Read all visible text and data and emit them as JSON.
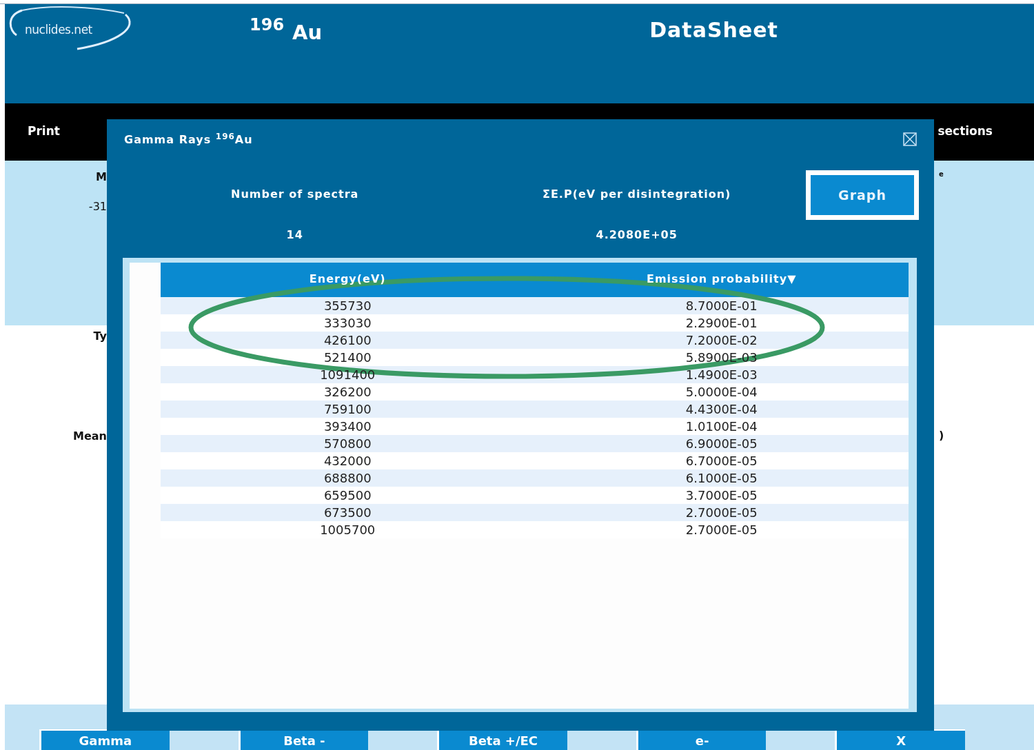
{
  "header": {
    "logo": "nuclides.net",
    "mass": "196",
    "symbol": "Au",
    "title": "DataSheet"
  },
  "toolbar": {
    "left": "Print",
    "right": "sections"
  },
  "background": {
    "left_fragments": [
      "M",
      "-31",
      "Ty",
      "Mean"
    ],
    "right_fragments": [
      "e",
      ")"
    ]
  },
  "dialog": {
    "title": "Gamma Rays",
    "mass": "196",
    "symbol": "Au",
    "stats": [
      {
        "label": "Number of spectra",
        "value": "14"
      },
      {
        "label": "ΣE.P(eV per disintegration)",
        "value": "4.2080E+05"
      }
    ],
    "graph_button": "Graph",
    "columns": [
      {
        "label": "Energy(eV)"
      },
      {
        "label": "Emission probability",
        "sort_mark": "▼"
      }
    ],
    "rows": [
      [
        "355730",
        "8.7000E-01"
      ],
      [
        "333030",
        "2.2900E-01"
      ],
      [
        "426100",
        "7.2000E-02"
      ],
      [
        "521400",
        "5.8900E-03"
      ],
      [
        "1091400",
        "1.4900E-03"
      ],
      [
        "326200",
        "5.0000E-04"
      ],
      [
        "759100",
        "4.4300E-04"
      ],
      [
        "393400",
        "1.0100E-04"
      ],
      [
        "570800",
        "6.9000E-05"
      ],
      [
        "432000",
        "6.7000E-05"
      ],
      [
        "688800",
        "6.1000E-05"
      ],
      [
        "659500",
        "3.7000E-05"
      ],
      [
        "673500",
        "2.7000E-05"
      ],
      [
        "1005700",
        "2.7000E-05"
      ]
    ]
  },
  "bottom_tabs": [
    "Gamma",
    "Beta -",
    "Beta +/EC",
    "e-",
    "X"
  ]
}
